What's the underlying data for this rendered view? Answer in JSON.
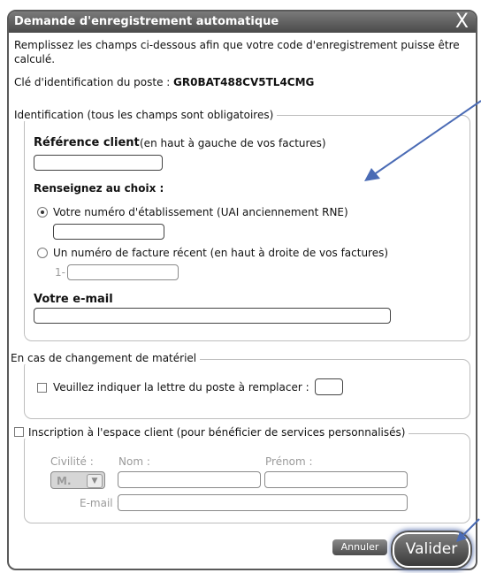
{
  "window": {
    "title": "Demande d'enregistrement automatique",
    "close_label": "X"
  },
  "intro": {
    "line1": "Remplissez les champs ci-dessous afin que votre code d'enregistrement puisse être",
    "line2": "calculé.",
    "cle_label": "Clé d'identification du poste :",
    "cle_value": "GR0BAT488CV5TL4CMG"
  },
  "identification": {
    "legend": "Identification (tous les champs sont obligatoires)",
    "ref_label": "Référence client",
    "ref_hint": "(en haut à gauche de vos factures)",
    "ref_value": "",
    "choix_label": "Renseignez au choix :",
    "option1_label": "Votre numéro d'établissement (UAI anciennement RNE)",
    "option1_selected": true,
    "option1_value": "",
    "option2_label": "Un numéro de facture récent (en haut à droite de vos factures)",
    "option2_selected": false,
    "option2_prefix": "1-",
    "option2_value": "",
    "email_label": "Votre e-mail",
    "email_value": ""
  },
  "materiel": {
    "legend": "En cas de changement de matériel",
    "checkbox_label": "Veuillez indiquer la lettre du poste à remplacer :",
    "checked": false,
    "letter_value": ""
  },
  "inscription": {
    "checkbox_label": "Inscription à l'espace client (pour bénéficier de services personnalisés)",
    "checked": false,
    "civilite_label": "Civilité :",
    "civilite_value": "M.",
    "nom_label": "Nom :",
    "prenom_label": "Prénom :",
    "email_label": "E-mail :"
  },
  "buttons": {
    "annuler": "Annuler",
    "valider": "Valider"
  },
  "colors": {
    "titlebar": "#5a5a5a",
    "arrow": "#4a6bb5",
    "valider_glow": "#6a7fb5"
  }
}
